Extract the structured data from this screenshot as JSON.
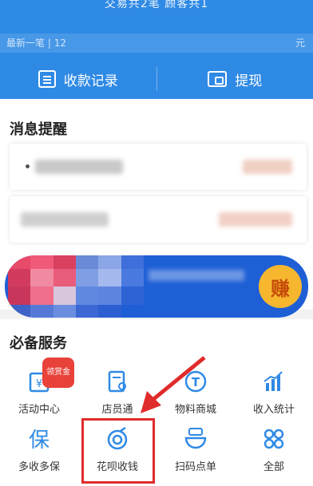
{
  "header": {
    "stats_text": "交易共2笔   顾客共1",
    "latest_label": "最新一笔",
    "latest_value": "12",
    "unit": "元",
    "records_label": "收款记录",
    "withdraw_label": "提现"
  },
  "messages": {
    "title": "消息提醒"
  },
  "banner": {
    "coin_text": "赚"
  },
  "services": {
    "title": "必备服务",
    "items": [
      {
        "label": "活动中心",
        "icon": "ticket-icon",
        "badge": "领赏金"
      },
      {
        "label": "店员通",
        "icon": "clerk-icon"
      },
      {
        "label": "物料商城",
        "icon": "t-coin-icon"
      },
      {
        "label": "收入统计",
        "icon": "bar-chart-icon"
      },
      {
        "label": "多收多保",
        "icon": "insurance-icon"
      },
      {
        "label": "花呗收钱",
        "icon": "huabei-icon"
      },
      {
        "label": "扫码点单",
        "icon": "bowl-icon"
      },
      {
        "label": "全部",
        "icon": "grid-icon"
      }
    ]
  },
  "colors": {
    "primary": "#2f8ae5",
    "highlight": "#e02b2b",
    "banner": "#1e5fd6"
  }
}
